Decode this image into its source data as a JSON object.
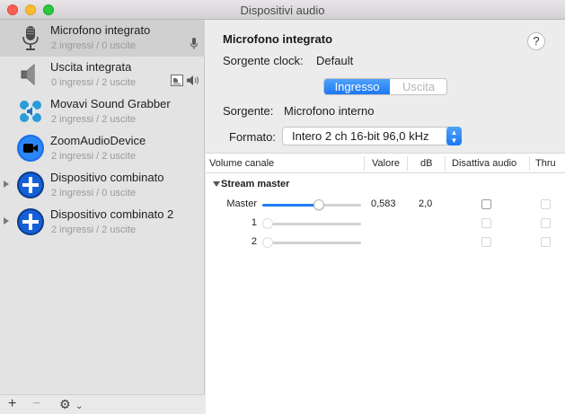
{
  "window": {
    "title": "Dispositivi audio"
  },
  "devices": [
    {
      "name": "Microfono integrato",
      "sub": "2 ingressi / 0 uscite",
      "icon": "microphone-icon",
      "selected": true
    },
    {
      "name": "Uscita integrata",
      "sub": "0 ingressi / 2 uscite",
      "icon": "speaker-icon"
    },
    {
      "name": "Movavi Sound Grabber",
      "sub": "2 ingressi / 2 uscite",
      "icon": "movavi-icon"
    },
    {
      "name": "ZoomAudioDevice",
      "sub": "2 ingressi / 2 uscite",
      "icon": "zoom-camera-icon"
    },
    {
      "name": "Dispositivo combinato",
      "sub": "2 ingressi / 0 uscite",
      "icon": "plus-circle-icon"
    },
    {
      "name": "Dispositivo combinato 2",
      "sub": "2 ingressi / 2 uscite",
      "icon": "plus-circle-icon"
    }
  ],
  "detail": {
    "title": "Microfono integrato",
    "help": "?",
    "clock_label": "Sorgente clock:",
    "clock_value": "Default",
    "tabs": {
      "input": "Ingresso",
      "output": "Uscita"
    },
    "source_label": "Sorgente:",
    "source_value": "Microfono interno",
    "format_label": "Formato:",
    "format_value": "Intero 2 ch 16-bit 96,0 kHz"
  },
  "table": {
    "headers": {
      "channel": "Volume canale",
      "value": "Valore",
      "db": "dB",
      "mute": "Disattiva audio",
      "thru": "Thru"
    },
    "group": "Stream master",
    "rows": [
      {
        "label": "Master",
        "level": 0.583,
        "value": "0,583",
        "db": "2,0"
      },
      {
        "label": "1",
        "level": 0,
        "value": "",
        "db": ""
      },
      {
        "label": "2",
        "level": 0,
        "value": "",
        "db": ""
      }
    ]
  },
  "colors": {
    "accent": "#1f7cf4"
  }
}
